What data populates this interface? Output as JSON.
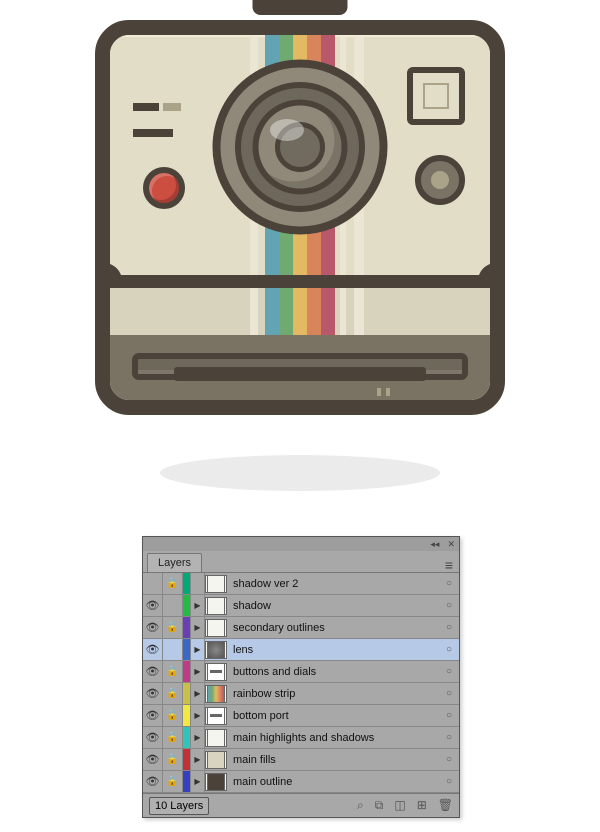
{
  "illustration": {
    "rainbow_colors": [
      "#62a4b4",
      "#71aa70",
      "#e3b963",
      "#d8855c",
      "#b8586a"
    ]
  },
  "panel": {
    "title": "Layers",
    "menu_icon": "≡",
    "collapse_icon": "◂◂",
    "close_icon": "✕",
    "footer_count": "10 Layers",
    "footer_icons": [
      "search-icon",
      "clip-icon",
      "new-sublayer-icon",
      "new-layer-icon",
      "trash-icon"
    ],
    "layers": [
      {
        "name": "shadow ver 2",
        "visible": false,
        "locked": true,
        "color": "#00aa77",
        "toggle": false,
        "thumb": "blank"
      },
      {
        "name": "shadow",
        "visible": true,
        "locked": false,
        "color": "#22bb44",
        "toggle": true,
        "thumb": "blank"
      },
      {
        "name": "secondary outlines",
        "visible": true,
        "locked": true,
        "color": "#6a3fb5",
        "toggle": true,
        "thumb": "blank"
      },
      {
        "name": "lens",
        "visible": true,
        "locked": false,
        "color": "#3a68c8",
        "toggle": true,
        "thumb": "lens",
        "selected": true
      },
      {
        "name": "buttons and dials",
        "visible": true,
        "locked": true,
        "color": "#c03a8a",
        "toggle": true,
        "thumb": "port"
      },
      {
        "name": "rainbow strip",
        "visible": true,
        "locked": true,
        "color": "#c8c04a",
        "toggle": true,
        "thumb": "rain"
      },
      {
        "name": "bottom port",
        "visible": true,
        "locked": true,
        "color": "#f2e840",
        "toggle": true,
        "thumb": "port"
      },
      {
        "name": "main highlights and shadows",
        "visible": true,
        "locked": true,
        "color": "#30c5b8",
        "toggle": true,
        "thumb": "blank"
      },
      {
        "name": "main fills",
        "visible": true,
        "locked": true,
        "color": "#c23038",
        "toggle": true,
        "thumb": "main"
      },
      {
        "name": "main outline",
        "visible": true,
        "locked": true,
        "color": "#3540c0",
        "toggle": true,
        "thumb": "outline"
      }
    ]
  }
}
